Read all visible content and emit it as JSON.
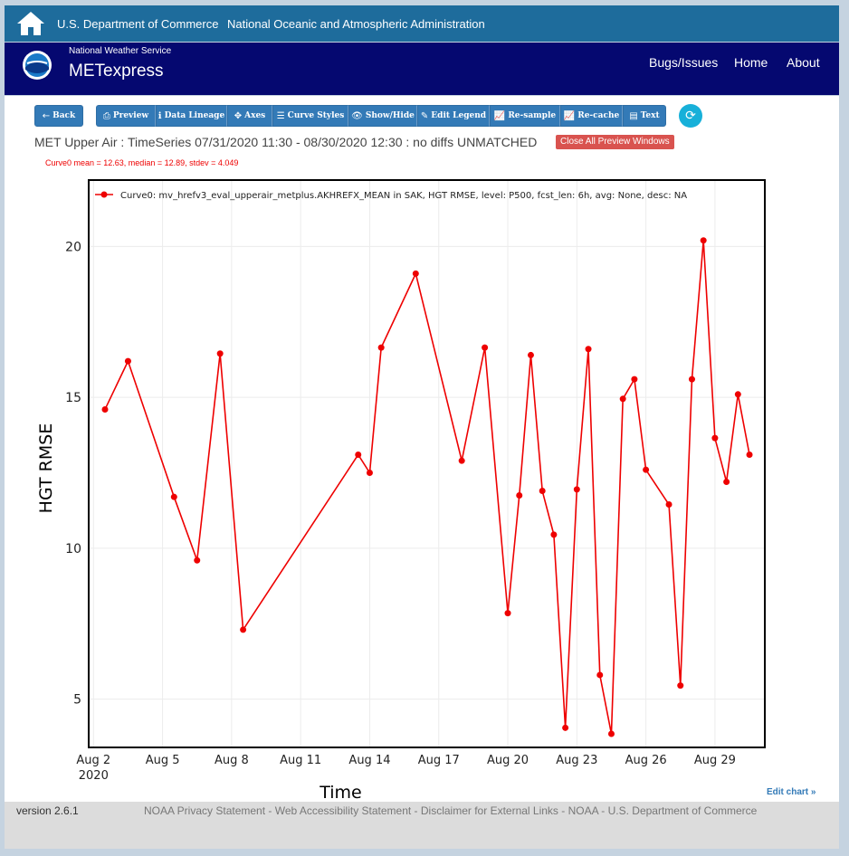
{
  "topbar": {
    "dept": "U.S. Department of Commerce",
    "agency": "National Oceanic and Atmospheric Administration",
    "home_icon": "home-icon"
  },
  "navbar": {
    "service": "National Weather Service",
    "brand": "METexpress",
    "logo_text": "NOAA",
    "links": [
      "Bugs/Issues",
      "Home",
      "About"
    ]
  },
  "toolbar": {
    "back": "Back",
    "preview": "Preview",
    "lineage": "Data Lineage",
    "axes": "Axes",
    "curve_styles": "Curve Styles",
    "show_hide": "Show/Hide",
    "edit_legend": "Edit Legend",
    "resample": "Re-sample",
    "recache": "Re-cache",
    "text": "Text"
  },
  "plot_title": "MET Upper Air : TimeSeries 07/31/2020 11:30 - 08/30/2020 12:30 : no diffs UNMATCHED",
  "close_all": "Close All Preview Windows",
  "stats": "Curve0 mean = 12.63, median = 12.89, stdev = 4.049",
  "edit_chart": "Edit chart »",
  "footer": {
    "version": "version 2.6.1",
    "links": "NOAA Privacy Statement - Web Accessibility Statement - Disclaimer for External Links - NOAA - U.S. Department of Commerce"
  },
  "colors": {
    "series": "#ee0000",
    "navbar": "#050870",
    "topbar": "#1e6c9c",
    "button": "#337ab7"
  },
  "chart_data": {
    "type": "line",
    "xlabel": "Time",
    "ylabel": "HGT RMSE",
    "x_ticks": [
      "Aug 2",
      "Aug 5",
      "Aug 8",
      "Aug 11",
      "Aug 14",
      "Aug 17",
      "Aug 20",
      "Aug 23",
      "Aug 26",
      "Aug 29"
    ],
    "x_year": "2020",
    "y_ticks": [
      "5",
      "10",
      "15",
      "20"
    ],
    "ylim": [
      3.4,
      22.2
    ],
    "xlim": [
      "2020-08-01T19:00",
      "2020-08-31T04:00"
    ],
    "grid": true,
    "legend_position": "top-left",
    "series": [
      {
        "name": "Curve0: mv_hrefv3_eval_upperair_metplus.AKHREFX_MEAN in SAK, HGT RMSE, level: P500, fcst_len: 6h, avg: None, desc: NA",
        "color": "#ee0000",
        "points": [
          [
            "2020-08-02T12:00",
            14.6
          ],
          [
            "2020-08-03T12:00",
            16.2
          ],
          [
            "2020-08-05T12:00",
            11.7
          ],
          [
            "2020-08-06T12:00",
            9.6
          ],
          [
            "2020-08-07T12:00",
            16.45
          ],
          [
            "2020-08-08T12:00",
            7.3
          ],
          [
            "2020-08-13T12:00",
            13.1
          ],
          [
            "2020-08-14T00:00",
            12.5
          ],
          [
            "2020-08-14T12:00",
            16.65
          ],
          [
            "2020-08-16T00:00",
            19.1
          ],
          [
            "2020-08-18T00:00",
            12.9
          ],
          [
            "2020-08-19T00:00",
            16.65
          ],
          [
            "2020-08-20T00:00",
            7.85
          ],
          [
            "2020-08-20T12:00",
            11.75
          ],
          [
            "2020-08-21T00:00",
            16.4
          ],
          [
            "2020-08-21T12:00",
            11.9
          ],
          [
            "2020-08-22T00:00",
            10.45
          ],
          [
            "2020-08-22T12:00",
            4.05
          ],
          [
            "2020-08-23T00:00",
            11.95
          ],
          [
            "2020-08-23T12:00",
            16.6
          ],
          [
            "2020-08-24T00:00",
            5.8
          ],
          [
            "2020-08-24T12:00",
            3.85
          ],
          [
            "2020-08-25T00:00",
            14.95
          ],
          [
            "2020-08-25T12:00",
            15.6
          ],
          [
            "2020-08-26T00:00",
            12.6
          ],
          [
            "2020-08-27T00:00",
            11.45
          ],
          [
            "2020-08-27T12:00",
            5.45
          ],
          [
            "2020-08-28T00:00",
            15.6
          ],
          [
            "2020-08-28T12:00",
            20.2
          ],
          [
            "2020-08-29T00:00",
            13.65
          ],
          [
            "2020-08-29T12:00",
            12.2
          ],
          [
            "2020-08-30T00:00",
            15.1
          ],
          [
            "2020-08-30T12:00",
            13.1
          ]
        ]
      }
    ]
  }
}
